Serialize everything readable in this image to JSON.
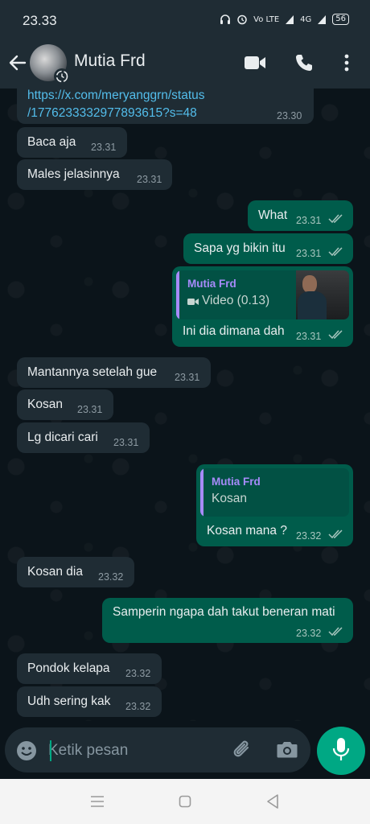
{
  "status_bar": {
    "time": "23.33",
    "network_label": "4G",
    "volte_label": "Vo LTE",
    "battery": "56"
  },
  "header": {
    "contact_name": "Mutia Frd"
  },
  "messages": [
    {
      "direction": "in",
      "link_line1": "https://x.com/meryanggrn/status",
      "link_line2": "/1776233332977893615?s=48",
      "time": "23.30"
    },
    {
      "direction": "in",
      "text": "Baca aja",
      "time": "23.31"
    },
    {
      "direction": "in",
      "text": "Males jelasinnya",
      "time": "23.31"
    },
    {
      "direction": "out",
      "text": "What",
      "time": "23.31",
      "read": true
    },
    {
      "direction": "out",
      "text": "Sapa yg bikin itu",
      "time": "23.31",
      "read": true
    },
    {
      "direction": "out",
      "quote_name": "Mutia Frd",
      "quote_text": "Video (0.13)",
      "text": "Ini dia dimana dah",
      "time": "23.31",
      "read": true
    },
    {
      "direction": "in",
      "text": "Mantannya setelah gue",
      "time": "23.31"
    },
    {
      "direction": "in",
      "text": "Kosan",
      "time": "23.31"
    },
    {
      "direction": "in",
      "text": "Lg dicari cari",
      "time": "23.31"
    },
    {
      "direction": "out",
      "quote_name": "Mutia Frd",
      "quote_text": "Kosan",
      "text": "Kosan mana ?",
      "time": "23.32",
      "read": true
    },
    {
      "direction": "in",
      "text": "Kosan dia",
      "time": "23.32"
    },
    {
      "direction": "out",
      "text": "Samperin ngapa dah takut beneran mati",
      "time": "23.32",
      "read": true
    },
    {
      "direction": "in",
      "text": "Pondok kelapa",
      "time": "23.32"
    },
    {
      "direction": "in",
      "text": "Udh sering kak",
      "time": "23.32"
    }
  ],
  "composer": {
    "placeholder": "Ketik pesan"
  },
  "colors": {
    "background": "#0b141a",
    "header": "#1f2c34",
    "incoming_bubble": "#1f2c34",
    "outgoing_bubble": "#005c4b",
    "accent_green": "#00a884",
    "link": "#53bdeb",
    "quote_name": "#a78bfa",
    "read_ticks": "#a8c6bf"
  },
  "icons": [
    "back-arrow-icon",
    "video-call-icon",
    "phone-icon",
    "more-vert-icon",
    "video-camera-small-icon",
    "double-check-icon",
    "emoji-icon",
    "paperclip-icon",
    "camera-icon",
    "microphone-icon",
    "nav-recents-icon",
    "nav-home-icon",
    "nav-back-icon"
  ]
}
